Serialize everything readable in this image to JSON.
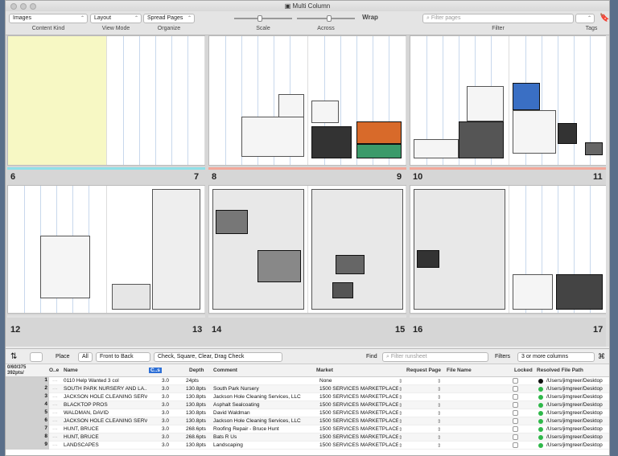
{
  "window": {
    "title": "Multi Column"
  },
  "toolbar": {
    "content_kind": {
      "value": "Images",
      "label": "Content Kind"
    },
    "view_mode": {
      "value": "Layout",
      "label": "View Mode"
    },
    "organize": {
      "value": "Spread Pages",
      "label": "Organize"
    },
    "scale_label": "Scale",
    "across_label": "Across",
    "wrap_label": "Wrap",
    "filter_placeholder": "Filter pages",
    "filter_label": "Filter",
    "tags_label": "Tags",
    "scale_level": 0.45,
    "across_level": 0.55
  },
  "pages": {
    "row1": [
      "6",
      "7",
      "8",
      "9",
      "10",
      "11"
    ],
    "row2": [
      "12",
      "13",
      "14",
      "15",
      "16",
      "17"
    ]
  },
  "bottombar": {
    "place_label": "Place",
    "place_value": "All",
    "order_value": "Front to Back",
    "check_value": "Check, Square, Clear, Drag Check",
    "find_label": "Find",
    "find_placeholder": "Filter runsheet",
    "filters_label": "Filters",
    "filters_value": "3 or more columns"
  },
  "table": {
    "summary_line1": "0/60/375",
    "summary_line2": "392pts/",
    "headers": {
      "oe": "O..e",
      "name": "Name",
      "cols": "C..s",
      "depth": "Depth",
      "comment": "Comment",
      "market": "Market",
      "request_page": "Request Page",
      "file_name": "File Name",
      "locked": "Locked",
      "resolved": "Resolved File Path"
    },
    "rows": [
      {
        "n": "1",
        "name": "0110 Help Wanted 3 col",
        "cols": "3.0",
        "depth": "24pts",
        "comment": "",
        "market": "None",
        "path": "/Users/jimgreer/Desktop",
        "dot": "#111111"
      },
      {
        "n": "2",
        "name": "SOUTH PARK NURSERY AND LA...",
        "cols": "3.0",
        "depth": "130.8pts",
        "comment": "South Park Nursery",
        "market": "1500 SERVICES MARKETPLACE",
        "path": "/Users/jimgreer/Desktop",
        "dot": "#2fb84a"
      },
      {
        "n": "3",
        "name": "JACKSON HOLE CLEANING SERV...",
        "cols": "3.0",
        "depth": "130.8pts",
        "comment": "Jackson Hole Cleaning Services, LLC",
        "market": "1500 SERVICES MARKETPLACE",
        "path": "/Users/jimgreer/Desktop",
        "dot": "#2fb84a"
      },
      {
        "n": "4",
        "name": "BLACKTOP PROS",
        "cols": "3.0",
        "depth": "130.8pts",
        "comment": "Asphalt Sealcoating",
        "market": "1500 SERVICES MARKETPLACE",
        "path": "/Users/jimgreer/Desktop",
        "dot": "#2fb84a"
      },
      {
        "n": "5",
        "name": "WALDMAN, DAVID",
        "cols": "3.0",
        "depth": "130.8pts",
        "comment": "David Waldman",
        "market": "1500 SERVICES MARKETPLACE",
        "path": "/Users/jimgreer/Desktop",
        "dot": "#2fb84a"
      },
      {
        "n": "6",
        "name": "JACKSON HOLE CLEANING SERV...",
        "cols": "3.0",
        "depth": "130.8pts",
        "comment": "Jackson Hole Cleaning Services, LLC",
        "market": "1500 SERVICES MARKETPLACE",
        "path": "/Users/jimgreer/Desktop",
        "dot": "#2fb84a"
      },
      {
        "n": "7",
        "name": "HUNT, BRUCE",
        "cols": "3.0",
        "depth": "268.6pts",
        "comment": "Roofing Repair - Bruce Hunt",
        "market": "1500 SERVICES MARKETPLACE",
        "path": "/Users/jimgreer/Desktop",
        "dot": "#2fb84a"
      },
      {
        "n": "8",
        "name": "HUNT, BRUCE",
        "cols": "3.0",
        "depth": "268.6pts",
        "comment": "Bats R Us",
        "market": "1500 SERVICES MARKETPLACE",
        "path": "/Users/jimgreer/Desktop",
        "dot": "#2fb84a"
      },
      {
        "n": "9",
        "name": "LANDSCAPES",
        "cols": "3.0",
        "depth": "130.8pts",
        "comment": "Landscaping",
        "market": "1500 SERVICES MARKETPLACE",
        "path": "/Users/jimgreer/Desktop",
        "dot": "#2fb84a"
      }
    ]
  },
  "colors": {
    "accent": "#2d6fd6",
    "yellow": "#f7f8c4",
    "cyan": "#8fe0e8",
    "salmon": "#f2a89a"
  }
}
